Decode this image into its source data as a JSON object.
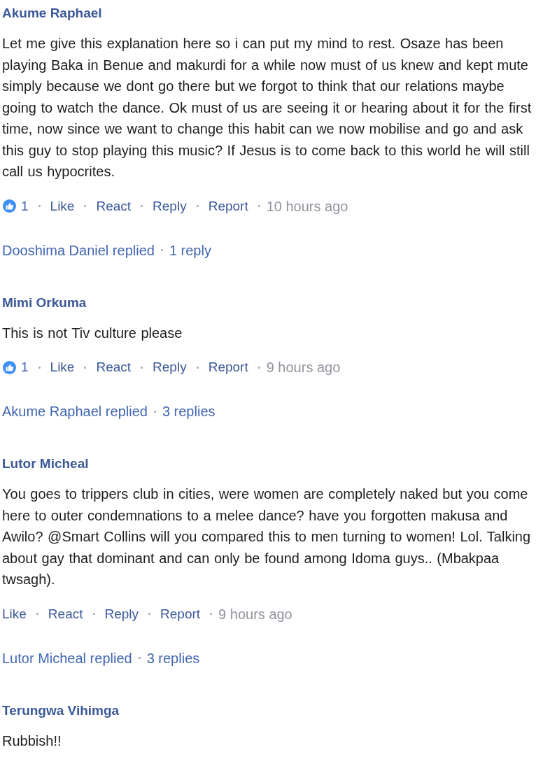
{
  "comments": [
    {
      "author": "Akume Raphael",
      "text": "Let me give this explanation here so i can put my mind to rest. Osaze has been playing Baka in Benue and makurdi for a while now must of us knew and kept mute simply because we dont go there but we forgot to think that our relations maybe going to watch the dance. Ok must of us are seeing it or hearing about it for the first time, now since we want to change this habit can we now mobilise and go and ask this guy to stop playing this music? If Jesus is to come back to this world he will still call us hypocrites.",
      "likes": "1",
      "actions": [
        "Like",
        "React",
        "Reply",
        "Report"
      ],
      "time": "10 hours ago",
      "replies": {
        "by": "Dooshima Daniel replied",
        "count": "1 reply"
      }
    },
    {
      "author": "Mimi Orkuma",
      "text": "This is not Tiv culture please",
      "likes": "1",
      "actions": [
        "Like",
        "React",
        "Reply",
        "Report"
      ],
      "time": "9 hours ago",
      "replies": {
        "by": "Akume Raphael replied",
        "count": "3 replies"
      }
    },
    {
      "author": "Lutor Micheal",
      "text": "You goes to trippers club in cities, were women are completely naked but you come here to outer condemnations to a melee dance? have you forgotten makusa and Awilo? @Smart Collins will you compared this to men turning to women! Lol. Talking about gay that dominant and can only be found among Idoma guys.. (Mbakpaa twsagh).",
      "actions": [
        "Like",
        "React",
        "Reply",
        "Report"
      ],
      "time": "9 hours ago",
      "replies": {
        "by": "Lutor Micheal replied",
        "count": "3 replies"
      }
    },
    {
      "author": "Terungwa Vihimga",
      "text": "Rubbish!!"
    }
  ]
}
